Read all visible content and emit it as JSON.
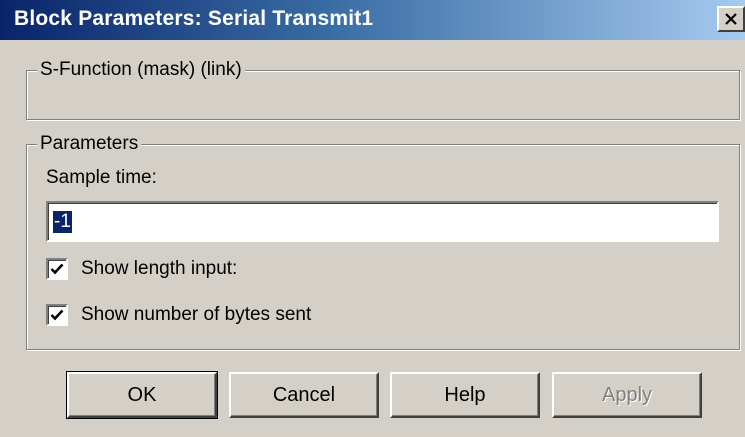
{
  "window": {
    "title": "Block Parameters: Serial Transmit1",
    "close_icon": "close-icon"
  },
  "groups": {
    "sfunction": {
      "label": "S-Function (mask) (link)"
    },
    "parameters": {
      "label": "Parameters"
    }
  },
  "fields": {
    "sample_time": {
      "label": "Sample time:",
      "value": "-1"
    }
  },
  "checkboxes": [
    {
      "label": "Show length input:",
      "checked": true
    },
    {
      "label": "Show number of bytes sent",
      "checked": true
    }
  ],
  "buttons": {
    "ok": "OK",
    "cancel": "Cancel",
    "help": "Help",
    "apply": "Apply"
  },
  "colors": {
    "titlebar_start": "#0a246a",
    "titlebar_end": "#a6caf0",
    "face": "#d4d0c8",
    "selection": "#0a246a",
    "disabled_text": "#808080"
  }
}
